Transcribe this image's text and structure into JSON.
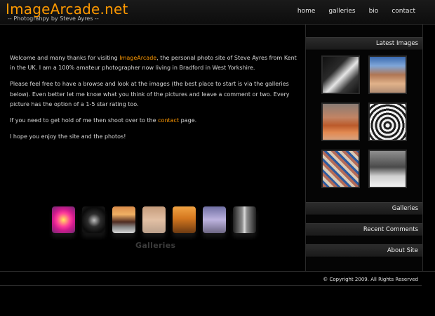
{
  "header": {
    "logo_title": "ImageArcade.net",
    "logo_sub": "-- Photograhpy by Steve Ayres --",
    "nav": [
      "home",
      "galleries",
      "bio",
      "contact"
    ]
  },
  "content": {
    "p1_pre": "Welcome and many thanks for visiting ",
    "p1_link": "ImageArcade",
    "p1_post": ", the personal photo site of Steve Ayres from Kent in the UK. I am a 100% amateur photographer now living in Bradford in West Yorkshire.",
    "p2": "Please feel free to have a browse and look at the images (the best place to start is via the galleries below). Even better let me know what you think of the pictures and leave a comment or two. Every picture has the option of a 1-5 star rating too.",
    "p3_pre": "If you need to get hold of me then shoot over to the ",
    "p3_link": "contact",
    "p3_post": " page.",
    "p4": "I hope you enjoy the site and the photos!"
  },
  "gallery_strip": {
    "caption": "Galleries"
  },
  "sidebar": {
    "latest_images_title": "Latest Images",
    "sections": [
      "Galleries",
      "Recent Comments",
      "About Site"
    ]
  },
  "footer": {
    "copyright": "© Copyright 2009. All Rights Reserved"
  },
  "colors": {
    "accent": "#ff9900",
    "background": "#000000"
  }
}
